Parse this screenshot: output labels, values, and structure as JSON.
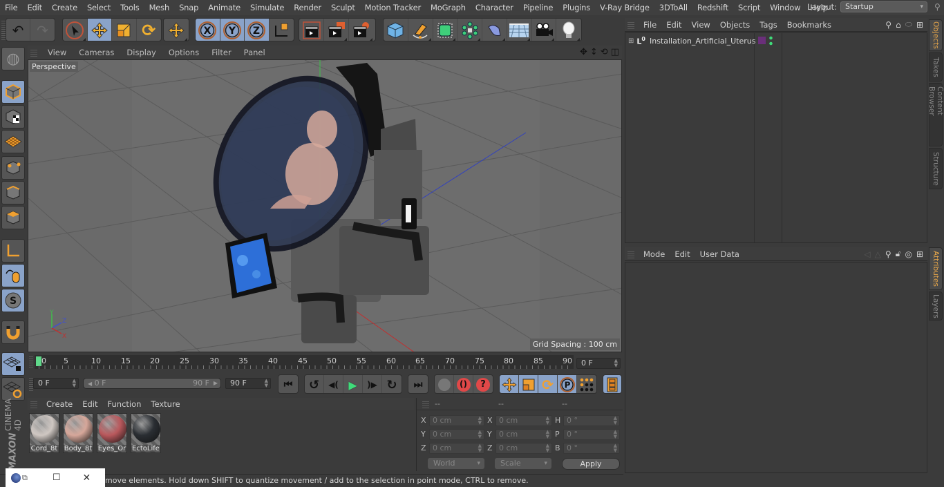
{
  "menubar": {
    "items": [
      "File",
      "Edit",
      "Create",
      "Select",
      "Tools",
      "Mesh",
      "Snap",
      "Animate",
      "Simulate",
      "Render",
      "Sculpt",
      "Motion Tracker",
      "MoGraph",
      "Character",
      "Pipeline",
      "Plugins",
      "V-Ray Bridge",
      "3DToAll",
      "Redshift",
      "Script",
      "Window",
      "Help"
    ],
    "layout_label": "Layout:",
    "layout_value": "Startup"
  },
  "toolbar": {
    "icons": [
      "undo-icon",
      "redo-icon",
      "live-selection-icon",
      "move-icon",
      "scale-icon",
      "rotate-icon",
      "recent-tool-icon",
      "x-axis-icon",
      "y-axis-icon",
      "z-axis-icon",
      "coordinate-system-icon",
      "render-view-icon",
      "render-picture-viewer-icon",
      "render-settings-icon",
      "cube-icon",
      "pen-spline-icon",
      "subdivision-icon",
      "cloner-icon",
      "deformer-icon",
      "floor-icon",
      "camera-icon",
      "light-icon"
    ]
  },
  "viewport": {
    "menu": [
      "View",
      "Cameras",
      "Display",
      "Options",
      "Filter",
      "Panel"
    ],
    "camera_label": "Perspective",
    "grid_spacing": "Grid Spacing : 100 cm",
    "axis_labels": {
      "x": "X",
      "y": "Y",
      "z": "Z"
    }
  },
  "timeline": {
    "ticks": [
      "0",
      "5",
      "10",
      "15",
      "20",
      "25",
      "30",
      "35",
      "40",
      "45",
      "50",
      "55",
      "60",
      "65",
      "70",
      "75",
      "80",
      "85",
      "90"
    ],
    "current_frame": "0 F",
    "start_frame": "0 F",
    "range_start": "0 F",
    "range_end": "90 F",
    "end_frame": "90 F"
  },
  "materials": {
    "menu": [
      "Create",
      "Edit",
      "Function",
      "Texture"
    ],
    "items": [
      {
        "name": "Cord_8t",
        "color": "#cfc7c2"
      },
      {
        "name": "Body_8t",
        "color": "#d6a79a"
      },
      {
        "name": "Eyes_Or",
        "color": "#b9585c"
      },
      {
        "name": "EctoLife",
        "color": "#2a2e33"
      }
    ]
  },
  "coordinates": {
    "headers": [
      "--",
      "--",
      "--"
    ],
    "position": {
      "X": "0 cm",
      "Y": "0 cm",
      "Z": "0 cm"
    },
    "size": {
      "X": "0 cm",
      "Y": "0 cm",
      "Z": "0 cm"
    },
    "rotation": {
      "H": "0 °",
      "P": "0 °",
      "B": "0 °"
    },
    "space_dropdown": "World",
    "mode_dropdown": "Scale",
    "apply_label": "Apply"
  },
  "object_manager": {
    "menu": [
      "File",
      "Edit",
      "View",
      "Objects",
      "Tags",
      "Bookmarks"
    ],
    "objects": [
      {
        "name": "Installation_Artificial_Uterus",
        "tag_color": "#6a2f7a"
      }
    ]
  },
  "attribute_manager": {
    "menu": [
      "Mode",
      "Edit",
      "User Data"
    ]
  },
  "side_tabs": {
    "top": [
      "Objects",
      "Takes",
      "Content Browser",
      "Structure"
    ],
    "bottom": [
      "Attributes",
      "Layers"
    ]
  },
  "status": {
    "text": "move elements. Hold down SHIFT to quantize movement / add to the selection in point mode, CTRL to remove."
  },
  "branding": {
    "maxon": "MAXON",
    "product": "CINEMA 4D"
  },
  "colors": {
    "accent": "#8aa3c9",
    "orange": "#f0a030",
    "active_tab": "#e6a64a",
    "timeline_cursor": "#5fd98a"
  }
}
